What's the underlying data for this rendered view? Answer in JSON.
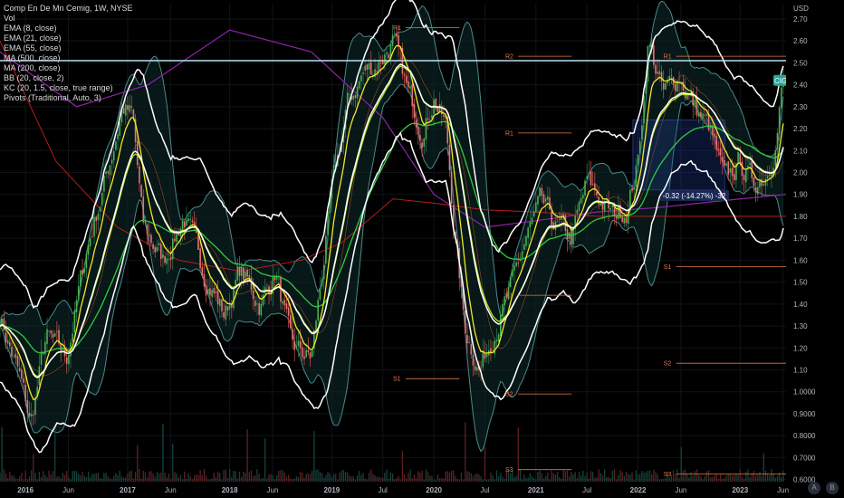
{
  "title": "Comp En De Mn Cemig, 1W, NYSE",
  "indicators": [
    "Vol",
    "EMA (8, close)",
    "EMA (21, close)",
    "EMA (55, close)",
    "MA (500, close)",
    "MA (200, close)",
    "BB (20, close, 2)",
    "KC (20, 1.5, close, true range)",
    "Pivots (Traditional, Auto, 3)"
  ],
  "currency": "USD",
  "price_labels": {
    "horizontal_line": "2.51",
    "symbol": "CIG",
    "last_price": "2.42"
  },
  "measure_label": "-0.32 (-14.27%) -32",
  "buttons": {
    "auto": "A",
    "log": "B"
  },
  "colors": {
    "up": "#26a69a",
    "down": "#ef5350",
    "ema8": "#f5e625",
    "ema21": "#b5e61d",
    "ema55": "#2ecc40",
    "ma200": "#8e24aa",
    "ma500": "#b71c1c",
    "kc": "#ffffff",
    "bb": "#4a8a8a",
    "pivot": "#e07a45",
    "hline": "#b8e0f0"
  },
  "chart_data": {
    "type": "line",
    "title": "Comp En De Mn Cemig, 1W, NYSE",
    "xlabel": "",
    "ylabel": "USD",
    "ylim": [
      0.59,
      2.77
    ],
    "y_ticks": [
      2.7,
      2.6,
      2.5,
      2.4,
      2.3,
      2.2,
      2.1,
      2.0,
      1.9,
      1.8,
      1.7,
      1.6,
      1.5,
      1.4,
      1.3,
      1.2,
      1.1,
      1.0,
      0.9,
      0.8,
      0.7,
      0.6
    ],
    "y_tick_labels": [
      "2.70",
      "2.60",
      "2.50",
      "2.40",
      "2.30",
      "2.20",
      "2.10",
      "2.00",
      "1.90",
      "1.80",
      "1.70",
      "1.60",
      "1.50",
      "1.40",
      "1.30",
      "1.20",
      "1.10",
      "1.0000",
      "0.9000",
      "0.8000",
      "0.7000",
      "0.6000"
    ],
    "x_ticks": [
      {
        "label": "2016",
        "x": 2016.0
      },
      {
        "label": "Jun",
        "x": 2016.42
      },
      {
        "label": "2017",
        "x": 2017.0
      },
      {
        "label": "Jun",
        "x": 2017.42
      },
      {
        "label": "2018",
        "x": 2018.0
      },
      {
        "label": "Jun",
        "x": 2018.42
      },
      {
        "label": "2019",
        "x": 2019.0
      },
      {
        "label": "Jul",
        "x": 2019.5
      },
      {
        "label": "2020",
        "x": 2020.0
      },
      {
        "label": "Jul",
        "x": 2020.5
      },
      {
        "label": "2021",
        "x": 2021.0
      },
      {
        "label": "Jul",
        "x": 2021.5
      },
      {
        "label": "2022",
        "x": 2022.0
      },
      {
        "label": "Jun",
        "x": 2022.42
      },
      {
        "label": "2023",
        "x": 2023.0
      },
      {
        "label": "Jun",
        "x": 2023.42
      }
    ],
    "xlim": [
      2015.75,
      2023.45
    ],
    "price_anchors": {
      "x": [
        2015.75,
        2015.95,
        2016.05,
        2016.2,
        2016.4,
        2016.6,
        2016.8,
        2016.95,
        2017.05,
        2017.15,
        2017.35,
        2017.55,
        2017.75,
        2017.95,
        2018.1,
        2018.3,
        2018.45,
        2018.6,
        2018.8,
        2019.0,
        2019.15,
        2019.3,
        2019.45,
        2019.6,
        2019.75,
        2019.9,
        2020.0,
        2020.12,
        2020.2,
        2020.3,
        2020.45,
        2020.6,
        2020.75,
        2020.9,
        2021.05,
        2021.2,
        2021.35,
        2021.5,
        2021.6,
        2021.75,
        2021.9,
        2022.0,
        2022.1,
        2022.25,
        2022.4,
        2022.55,
        2022.7,
        2022.85,
        2023.0,
        2023.12,
        2023.25,
        2023.35,
        2023.42
      ],
      "y": [
        1.35,
        1.05,
        0.85,
        1.25,
        1.15,
        1.65,
        2.0,
        2.3,
        2.25,
        1.75,
        1.6,
        1.8,
        1.55,
        1.35,
        1.55,
        1.4,
        1.55,
        1.2,
        1.15,
        1.9,
        2.3,
        2.45,
        2.5,
        2.6,
        2.35,
        2.2,
        2.35,
        2.2,
        1.75,
        1.3,
        1.1,
        1.3,
        1.45,
        1.7,
        1.85,
        1.75,
        1.7,
        1.95,
        1.9,
        1.8,
        1.85,
        2.05,
        2.6,
        2.35,
        2.45,
        2.3,
        2.2,
        1.95,
        2.05,
        1.95,
        2.0,
        2.15,
        2.42
      ]
    },
    "series": [
      {
        "name": "EMA (8, close)",
        "period": 8
      },
      {
        "name": "EMA (21, close)",
        "period": 21
      },
      {
        "name": "EMA (55, close)",
        "period": 55
      },
      {
        "name": "MA (200, close)",
        "values_x": [
          2015.75,
          2016.5,
          2017.2,
          2018.0,
          2018.8,
          2019.5,
          2020.0,
          2020.5,
          2021.0,
          2021.6,
          2022.2,
          2022.8,
          2023.45
        ],
        "values_y": [
          2.55,
          2.3,
          2.4,
          2.65,
          2.55,
          2.25,
          1.9,
          1.75,
          1.78,
          1.82,
          1.84,
          1.87,
          1.9
        ]
      },
      {
        "name": "MA (500, close)",
        "values_x": [
          2015.75,
          2016.3,
          2016.9,
          2017.5,
          2018.1,
          2018.7,
          2019.1,
          2019.6,
          2020.0,
          2020.5,
          2021.0,
          2021.6,
          2022.2,
          2022.8,
          2023.45
        ],
        "values_y": [
          2.6,
          2.05,
          1.75,
          1.6,
          1.55,
          1.6,
          1.68,
          1.88,
          1.86,
          1.83,
          1.82,
          1.8,
          1.8,
          1.8,
          1.8
        ]
      }
    ],
    "pivots": [
      {
        "label": "R1",
        "value": 2.66,
        "x0": 2019.6,
        "x1": 2020.25
      },
      {
        "label": "S1",
        "value": 1.06,
        "x0": 2019.6,
        "x1": 2020.25
      },
      {
        "label": "R2",
        "value": 2.53,
        "x0": 2020.7,
        "x1": 2021.35
      },
      {
        "label": "R1",
        "value": 2.18,
        "x0": 2020.7,
        "x1": 2021.35
      },
      {
        "label": "S1",
        "value": 1.44,
        "x0": 2020.7,
        "x1": 2021.35
      },
      {
        "label": "S2",
        "value": 0.99,
        "x0": 2020.7,
        "x1": 2021.35
      },
      {
        "label": "S3",
        "value": 0.645,
        "x0": 2020.7,
        "x1": 2021.35
      },
      {
        "label": "R1",
        "value": 2.53,
        "x0": 2022.25,
        "x1": 2023.45
      },
      {
        "label": "S1",
        "value": 1.57,
        "x0": 2022.25,
        "x1": 2023.45
      },
      {
        "label": "S2",
        "value": 1.13,
        "x0": 2022.25,
        "x1": 2023.45
      },
      {
        "label": "S3",
        "value": 0.625,
        "x0": 2022.25,
        "x1": 2023.45
      }
    ],
    "horizontal_line": 2.51,
    "last_price": 2.42,
    "measure_box": {
      "x0": 2021.95,
      "x1": 2022.85,
      "y0": 1.92,
      "y1": 2.24
    }
  }
}
